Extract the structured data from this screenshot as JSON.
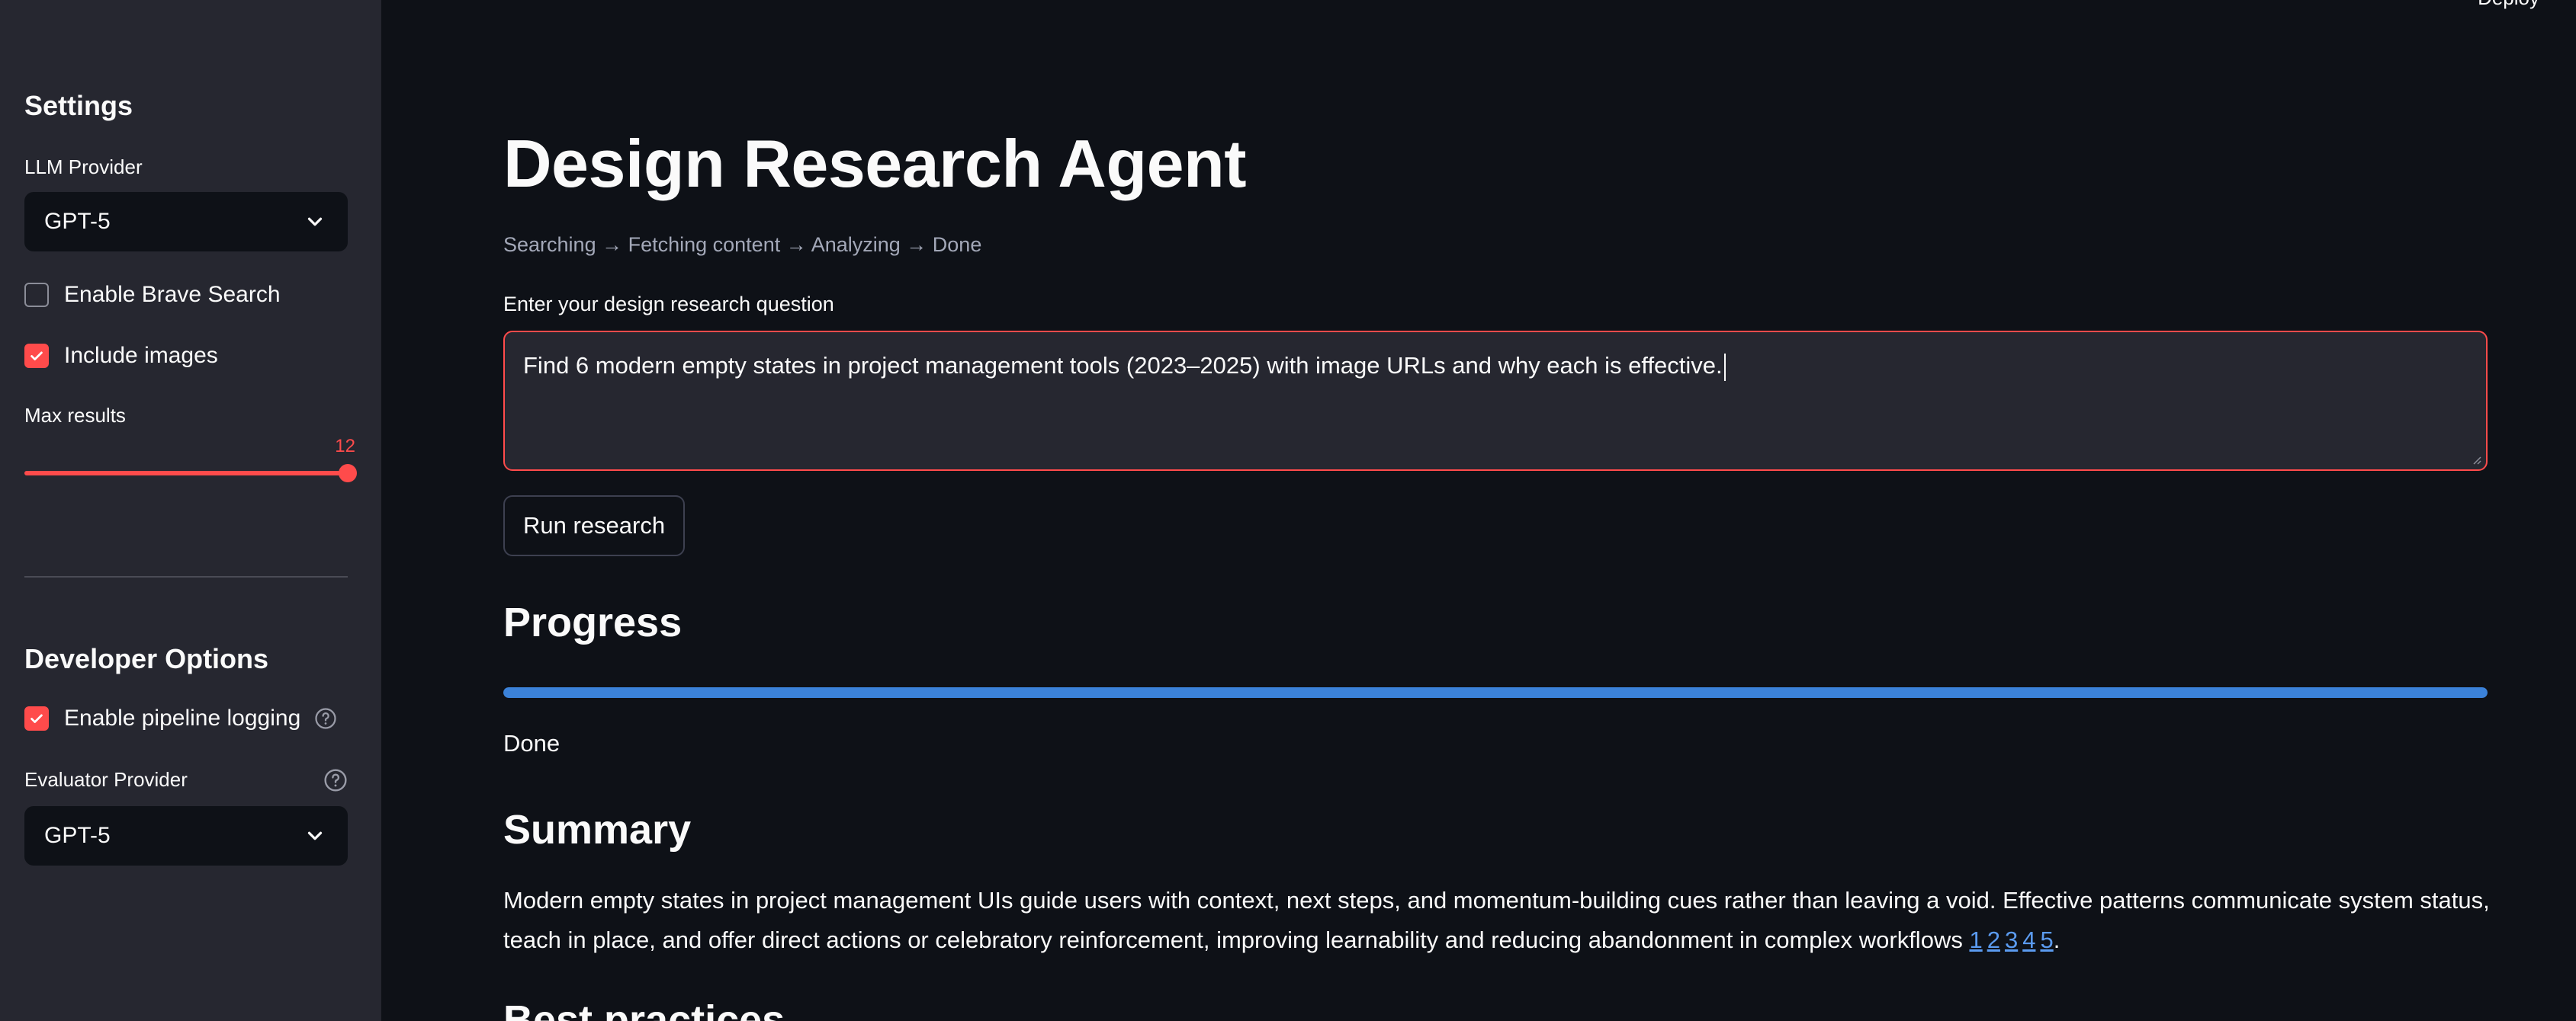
{
  "sidebar": {
    "settings_heading": "Settings",
    "llm_provider_label": "LLM Provider",
    "llm_provider_value": "GPT-5",
    "brave_search_label": "Enable Brave Search",
    "brave_search_checked": false,
    "include_images_label": "Include images",
    "include_images_checked": true,
    "max_results_label": "Max results",
    "max_results_value": "12",
    "max_results_fraction": 1.0,
    "developer_heading": "Developer Options",
    "pipeline_logging_label": "Enable pipeline logging",
    "pipeline_logging_checked": true,
    "evaluator_label": "Evaluator Provider",
    "evaluator_value": "GPT-5"
  },
  "header": {
    "deploy_label": "Deploy"
  },
  "main": {
    "title": "Design Research Agent",
    "caption": "Searching → Fetching content → Analyzing → Done",
    "question_label": "Enter your design research question",
    "question_value": "Find 6 modern empty states in project management tools (2023–2025) with image URLs and why each is effective.",
    "run_button": "Run research",
    "progress_heading": "Progress",
    "progress_fraction": 1.0,
    "progress_status": "Done",
    "summary_heading": "Summary",
    "summary_text": "Modern empty states in project management UIs guide users with context, next steps, and momentum-building cues rather than leaving a void. Effective patterns communicate system status, teach in place, and offer direct actions or celebratory reinforcement, improving learnability and reducing abandonment in complex workflows ",
    "citations": [
      "1",
      "2",
      "3",
      "4",
      "5"
    ],
    "summary_end": ".",
    "next_heading": "Best practices"
  },
  "colors": {
    "accent": "#ff4b4b",
    "progress": "#3b82d9",
    "link": "#5b9bf0",
    "background": "#0e1117",
    "sidebar": "#262730"
  }
}
